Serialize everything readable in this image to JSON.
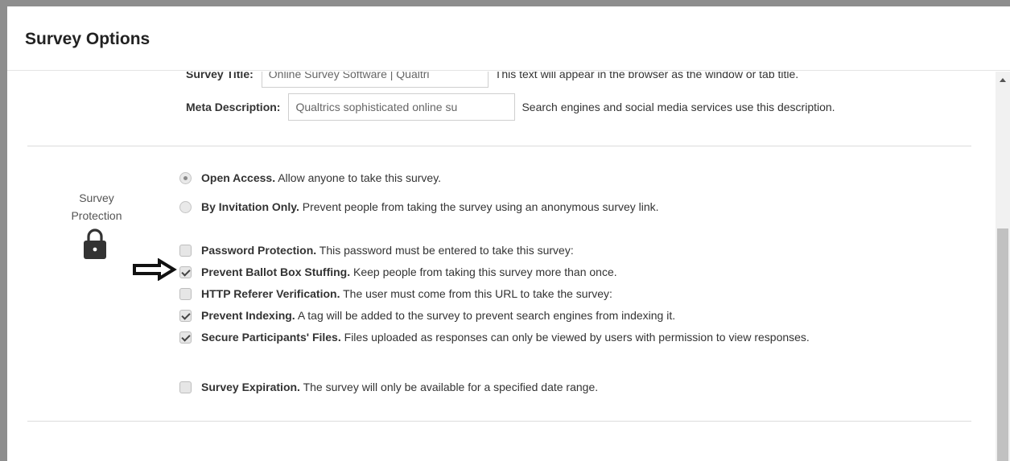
{
  "dialog": {
    "title": "Survey Options"
  },
  "title_field": {
    "label": "Survey Title:",
    "value": "Online Survey Software | Qualtri",
    "hint": "This text will appear in the browser as the window or tab title."
  },
  "meta_field": {
    "label": "Meta Description:",
    "value": "Qualtrics sophisticated online su",
    "hint": "Search engines and social media services use this description."
  },
  "protection": {
    "section_label_line1": "Survey",
    "section_label_line2": "Protection",
    "lock_icon": "lock-icon",
    "radios": [
      {
        "title": "Open Access.",
        "desc": "Allow anyone to take this survey.",
        "selected": true
      },
      {
        "title": "By Invitation Only.",
        "desc": "Prevent people from taking the survey using an anonymous survey link.",
        "selected": false
      }
    ],
    "checkboxes": [
      {
        "title": "Password Protection.",
        "desc": "This password must be entered to take this survey:",
        "checked": false
      },
      {
        "title": "Prevent Ballot Box Stuffing.",
        "desc": "Keep people from taking this survey more than once.",
        "checked": true
      },
      {
        "title": "HTTP Referer Verification.",
        "desc": "The user must come from this URL to take the survey:",
        "checked": false
      },
      {
        "title": "Prevent Indexing.",
        "desc": "A tag will be added to the survey to prevent search engines from indexing it.",
        "checked": true
      },
      {
        "title": "Secure Participants' Files.",
        "desc": "Files uploaded as responses can only be viewed by users with permission to view responses.",
        "checked": true
      },
      {
        "title": "Survey Expiration.",
        "desc": "The survey will only be available for a specified date range.",
        "checked": false
      }
    ]
  },
  "annotation": {
    "arrow_icon": "arrow-right-icon"
  }
}
